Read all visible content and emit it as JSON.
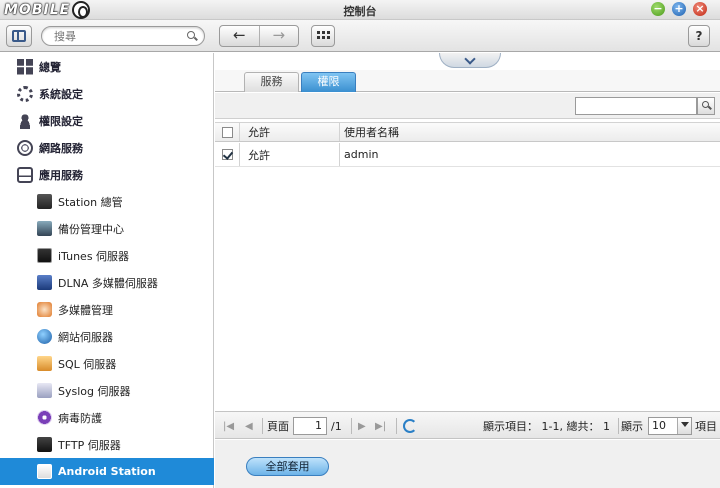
{
  "window": {
    "title": "控制台"
  },
  "logo": {
    "text": "MOBILE"
  },
  "toolbar": {
    "search_placeholder": "搜尋",
    "help_label": "?"
  },
  "sidebar": {
    "items": [
      {
        "label": "總覽",
        "level": "top",
        "icon": "overview-icon"
      },
      {
        "label": "系統設定",
        "level": "top",
        "icon": "gear-icon"
      },
      {
        "label": "權限設定",
        "level": "top",
        "icon": "user-icon"
      },
      {
        "label": "網路服務",
        "level": "top",
        "icon": "globe-icon"
      },
      {
        "label": "應用服務",
        "level": "top",
        "icon": "drive-icon"
      },
      {
        "label": "Station 總管",
        "level": "sub",
        "icon": "station-icon"
      },
      {
        "label": "備份管理中心",
        "level": "sub",
        "icon": "backup-icon"
      },
      {
        "label": "iTunes 伺服器",
        "level": "sub",
        "icon": "itunes-icon"
      },
      {
        "label": "DLNA 多媒體伺服器",
        "level": "sub",
        "icon": "dlna-icon"
      },
      {
        "label": "多媒體管理",
        "level": "sub",
        "icon": "multimedia-icon"
      },
      {
        "label": "網站伺服器",
        "level": "sub",
        "icon": "web-server-icon"
      },
      {
        "label": "SQL 伺服器",
        "level": "sub",
        "icon": "sql-icon"
      },
      {
        "label": "Syslog 伺服器",
        "level": "sub",
        "icon": "syslog-icon"
      },
      {
        "label": "病毒防護",
        "level": "sub",
        "icon": "antivirus-icon"
      },
      {
        "label": "TFTP 伺服器",
        "level": "sub",
        "icon": "tftp-icon"
      },
      {
        "label": "Android Station",
        "level": "sub",
        "icon": "android-icon",
        "active": true
      }
    ]
  },
  "main": {
    "tabs": [
      {
        "label": "服務",
        "active": false
      },
      {
        "label": "權限",
        "active": true
      }
    ],
    "table": {
      "headers": [
        "允許",
        "使用者名稱"
      ],
      "rows": [
        {
          "allow_label": "允許",
          "user": "admin",
          "checked": true
        }
      ]
    },
    "pager": {
      "page_label": "頁面",
      "page_value": "1",
      "total_pages": "/1",
      "display_info": "顯示項目： 1-1, 總共： 1",
      "show_label": "顯示",
      "per_page": "10",
      "items_label": "項目"
    },
    "apply_label": "全部套用"
  },
  "colors": {
    "accent": "#1f8ad8",
    "tab_active": "#3a8fd0"
  }
}
